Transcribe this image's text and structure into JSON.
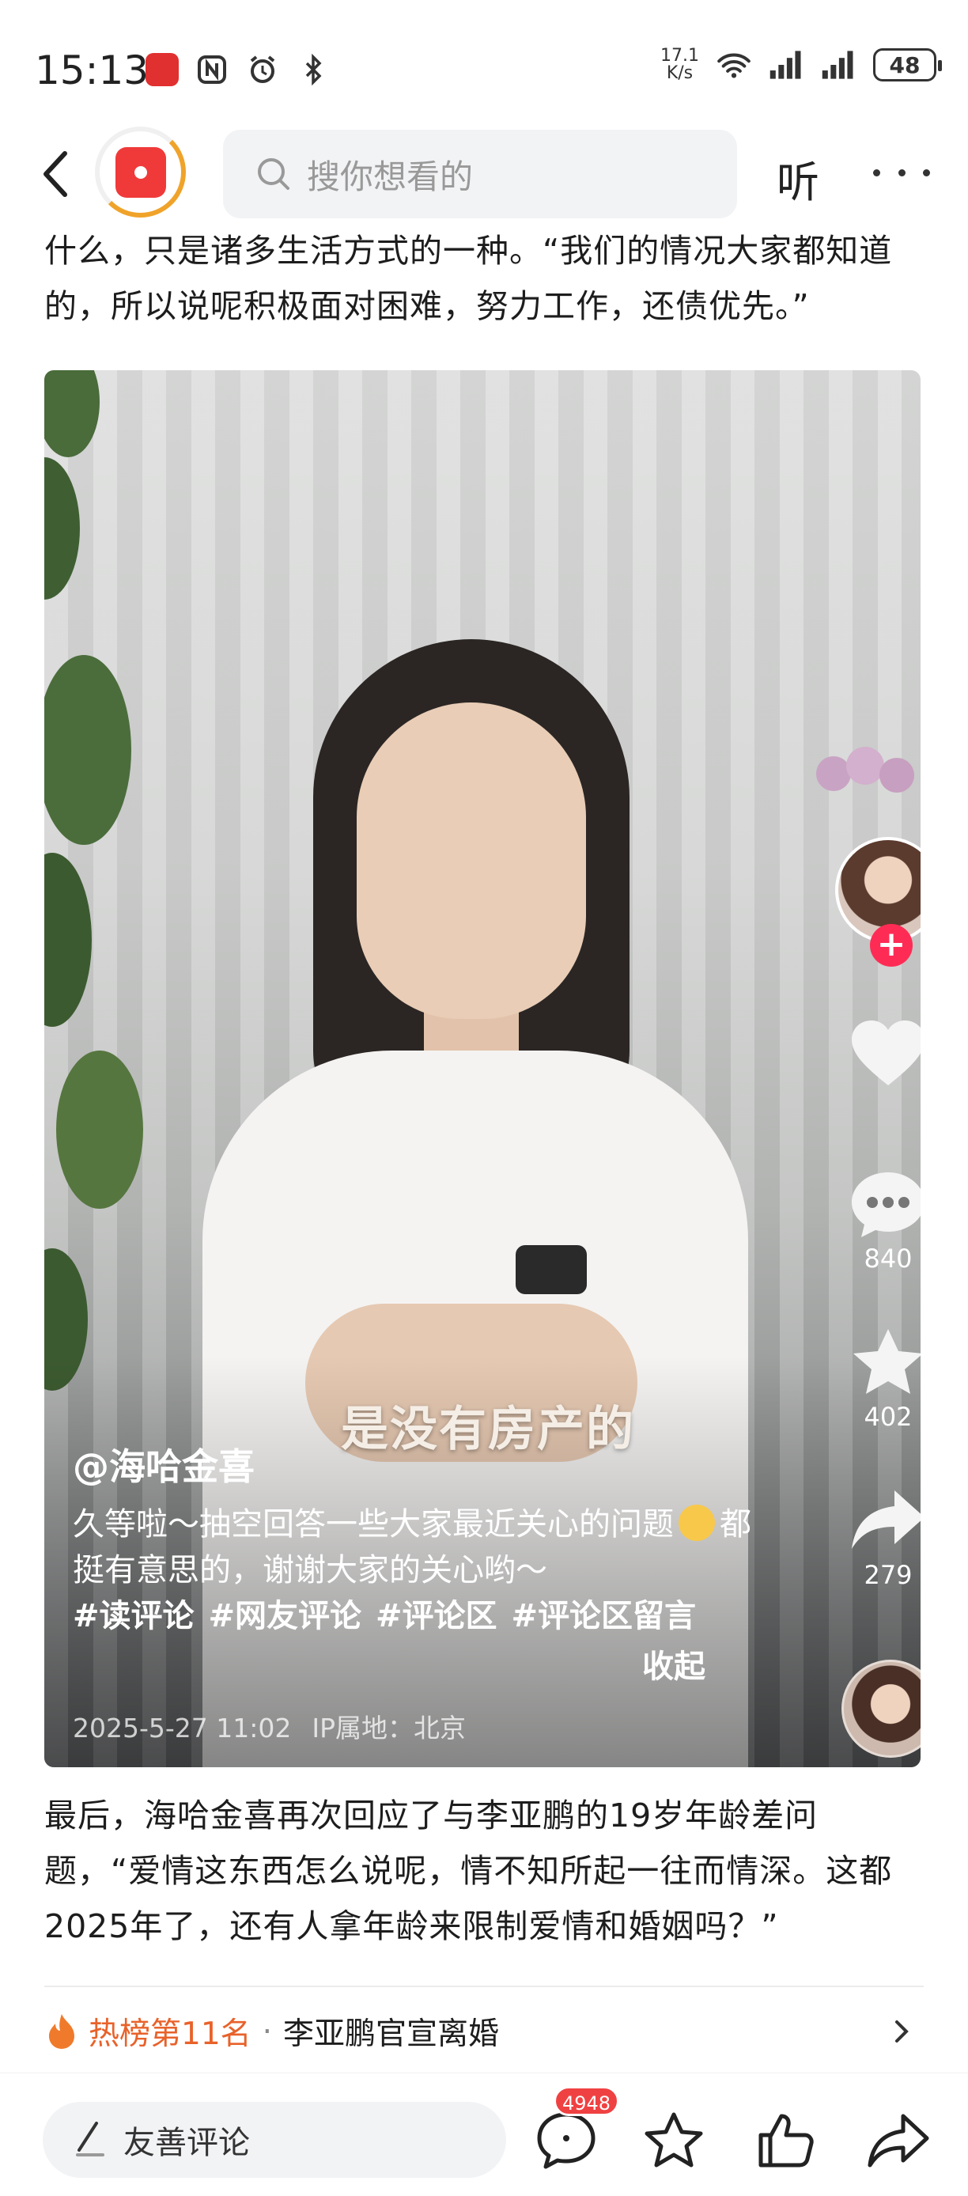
{
  "status_bar": {
    "time": "15:13",
    "net_speed_value": "17.1",
    "net_speed_unit": "K/s",
    "battery": "48"
  },
  "nav": {
    "search_placeholder": "搜你想看的",
    "listen_label": "听"
  },
  "article": {
    "paragraph_before": "什么，只是诸多生活方式的一种。“我们的情况大家都知道的，所以说呢积极面对困难，努力工作，还债优先。”",
    "paragraph_after": "最后，海哈金喜再次回应了与李亚鹏的19岁年龄差问题，“爱情这东西怎么说呢，情不知所起一往而情深。这都2025年了，还有人拿年龄来限制爱情和婚姻吗？”"
  },
  "video": {
    "subtitle": "是没有房产的",
    "author": "@海哈金喜",
    "description_part1": "久等啦～抽空回答一些大家最近关心的问题",
    "description_part2": "都挺有意思的，谢谢大家的关心哟～",
    "hashtags": [
      "#读评论",
      "#网友评论",
      "#评论区",
      "#评论区留言"
    ],
    "collapse_label": "收起",
    "date": "2025-5-27 11:02",
    "ip_location": "IP属地：北京",
    "comment_count": "840",
    "favorite_count": "402",
    "share_count": "279"
  },
  "hot_list": {
    "rank": "热榜第11名",
    "separator": "·",
    "topic": "李亚鹏官宣离婚"
  },
  "bottom_bar": {
    "comment_placeholder": "友善评论",
    "comment_badge": "4948"
  },
  "colors": {
    "accent_red": "#f04142",
    "hot_orange": "#e8622a",
    "follow_pink": "#fe2c55"
  },
  "icons": [
    "back-arrow-icon",
    "search-icon",
    "more-icon",
    "heart-icon",
    "comment-bubble-icon",
    "star-icon",
    "share-arrow-icon",
    "fire-icon",
    "chevron-right-icon",
    "pen-icon",
    "thumbs-up-icon"
  ]
}
